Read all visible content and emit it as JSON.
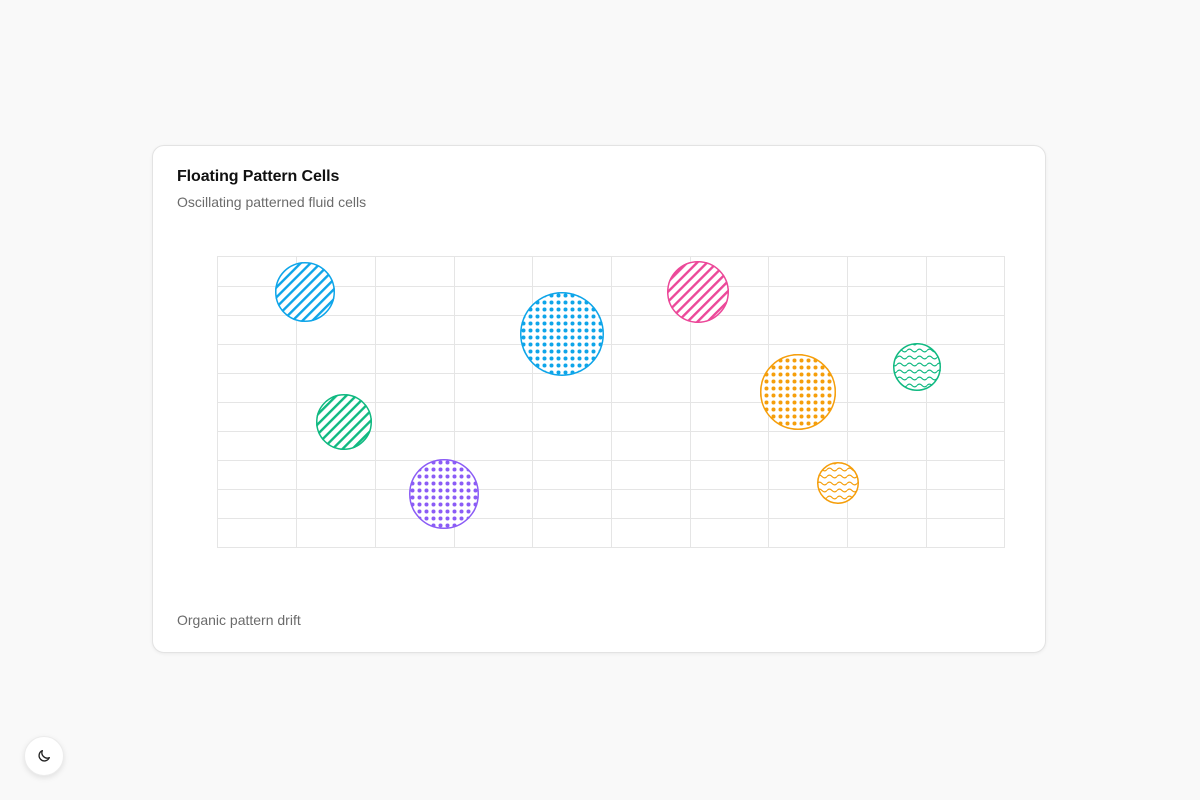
{
  "card": {
    "title": "Floating Pattern Cells",
    "subtitle": "Oscillating patterned fluid cells",
    "footer": "Organic pattern drift"
  },
  "grid": {
    "color": "#e5e5e5"
  },
  "cells": [
    {
      "name": "cell-blue-stripes",
      "pattern": "stripes",
      "color": "#0ea5e9"
    },
    {
      "name": "cell-green-stripes",
      "pattern": "stripes",
      "color": "#10b981"
    },
    {
      "name": "cell-purple-dots",
      "pattern": "dots",
      "color": "#8b5cf6"
    },
    {
      "name": "cell-blue-dots",
      "pattern": "dots",
      "color": "#0ea5e9"
    },
    {
      "name": "cell-pink-stripes",
      "pattern": "stripes",
      "color": "#ec4899"
    },
    {
      "name": "cell-orange-dots",
      "pattern": "dots",
      "color": "#f59e0b"
    },
    {
      "name": "cell-green-waves",
      "pattern": "waves",
      "color": "#10b981"
    },
    {
      "name": "cell-orange-waves",
      "pattern": "waves",
      "color": "#f59e0b"
    }
  ],
  "theme_toggle": {
    "icon": "moon-icon"
  }
}
